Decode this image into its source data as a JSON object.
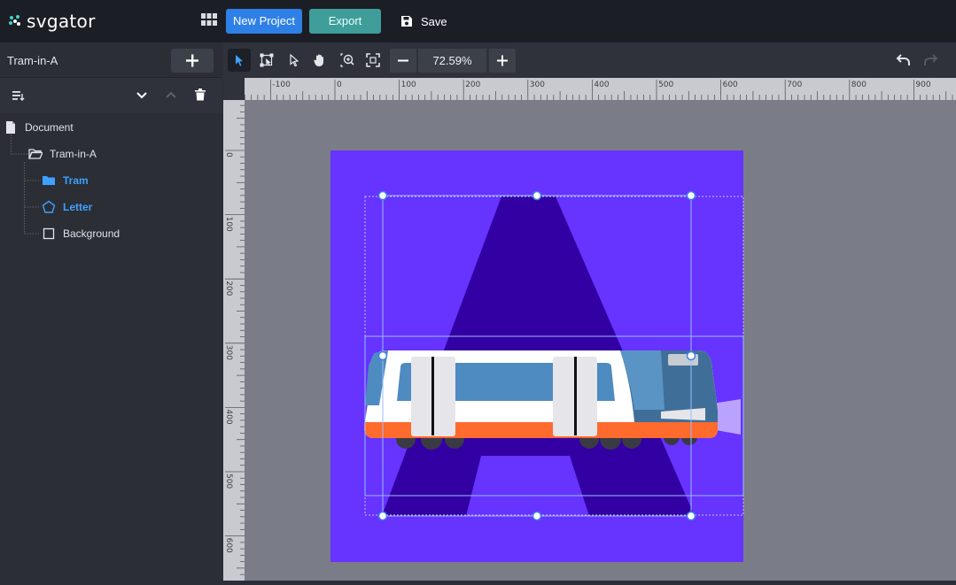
{
  "app": {
    "logo_text": "svgator",
    "new_project_label": "New Project",
    "export_label": "Export",
    "save_label": "Save"
  },
  "sidebar": {
    "project_name": "Tram-in-A",
    "tree": [
      {
        "label": "Document",
        "icon": "document-icon",
        "active": false
      },
      {
        "label": "Tram-in-A",
        "icon": "folder-open-icon",
        "active": false
      },
      {
        "label": "Tram",
        "icon": "folder-icon",
        "active": true
      },
      {
        "label": "Letter",
        "icon": "pentagon-icon",
        "active": true
      },
      {
        "label": "Background",
        "icon": "square-icon",
        "active": false
      }
    ]
  },
  "toolbar": {
    "zoom_value": "72.59%",
    "tools": [
      "select-arrow-icon",
      "transform-icon",
      "node-select-icon",
      "hand-icon",
      "zoom-area-icon",
      "fit-screen-icon"
    ]
  },
  "rulers": {
    "top_labels": [
      "-100",
      "0",
      "100",
      "200",
      "300",
      "400",
      "500",
      "600",
      "700",
      "800",
      "900"
    ],
    "left_labels": [
      "0",
      "100",
      "200",
      "300",
      "400",
      "500",
      "600"
    ]
  },
  "colors": {
    "accent_blue": "#2f80e6",
    "export_teal": "#3f9d9a",
    "artboard_purple": "#6633ff",
    "letter_dark": "#3300a3",
    "active_tree": "#3ea1ff"
  }
}
